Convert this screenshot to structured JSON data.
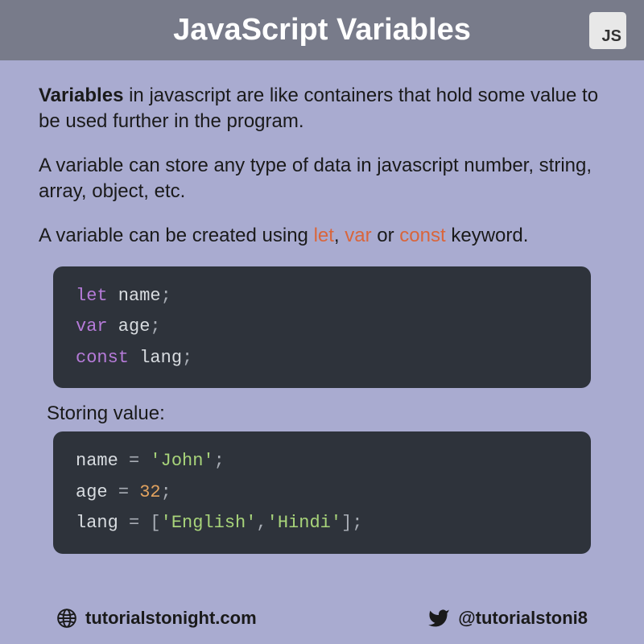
{
  "header": {
    "title": "JavaScript Variables",
    "badge": "JS"
  },
  "paragraphs": {
    "intro_bold": "Variables",
    "intro_rest": " in javascript are like containers that hold some value to be used further in the program.",
    "types": "A variable can store any type of data in javascript number, string, array, object, etc.",
    "createPrefix": "A variable can be created using ",
    "kw_let": "let",
    "sep1": ", ",
    "kw_var": "var",
    "sep2": " or ",
    "kw_const": "const",
    "createSuffix": " keyword."
  },
  "code1": {
    "line1": {
      "kw": "let",
      "ident": " name",
      "punct": ";"
    },
    "line2": {
      "kw": "var",
      "ident": " age",
      "punct": ";"
    },
    "line3": {
      "kw": "const",
      "ident": " lang",
      "punct": ";"
    }
  },
  "subhead": "Storing value:",
  "code2": {
    "line1": {
      "ident": "name ",
      "op": "=",
      "str": " 'John'",
      "punct": ";"
    },
    "line2": {
      "ident": "age ",
      "op": "=",
      "num": " 32",
      "punct": ";"
    },
    "line3": {
      "ident": "lang ",
      "op": "=",
      "bracket_open": " [",
      "str1": "'English'",
      "comma": ",",
      "str2": "'Hindi'",
      "bracket_close": "]",
      "punct": ";"
    }
  },
  "footer": {
    "website": "tutorialstonight.com",
    "handle": "@tutorialstoni8"
  }
}
